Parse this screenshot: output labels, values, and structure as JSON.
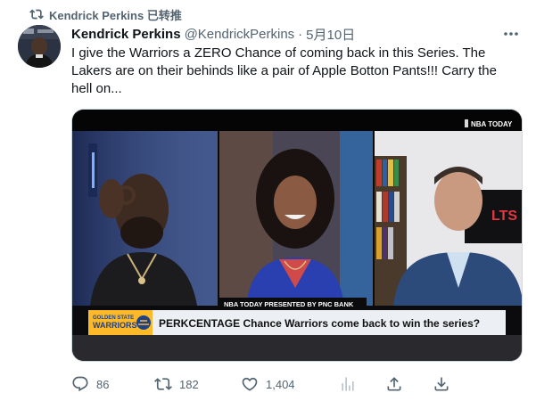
{
  "retweet": {
    "label": "Kendrick Perkins 已转推"
  },
  "author": {
    "name": "Kendrick Perkins",
    "handle": "@KendrickPerkins",
    "separator": "·",
    "date": "5月10日"
  },
  "tweet": {
    "text": "I give the Warriors a ZERO Chance of coming back in this Series. The Lakers are on their behinds like a pair of Apple Botton Pants!!! Carry the hell on..."
  },
  "media": {
    "network_logo": "NBA TODAY",
    "bar_label": "NBA TODAY PRESENTED BY PNC BANK",
    "team_label_line1": "GOLDEN STATE",
    "team_label_line2": "WARRIORS",
    "headline": "PERKCENTAGE Chance Warriors come back to win the series?",
    "bg_sign": "LTS"
  },
  "actions": {
    "replies": "86",
    "retweets": "182",
    "likes": "1,404"
  },
  "colors": {
    "accent": "#1d9bf0",
    "muted": "#536471",
    "warriors_gold": "#fdb927",
    "warriors_blue": "#1d428a"
  }
}
